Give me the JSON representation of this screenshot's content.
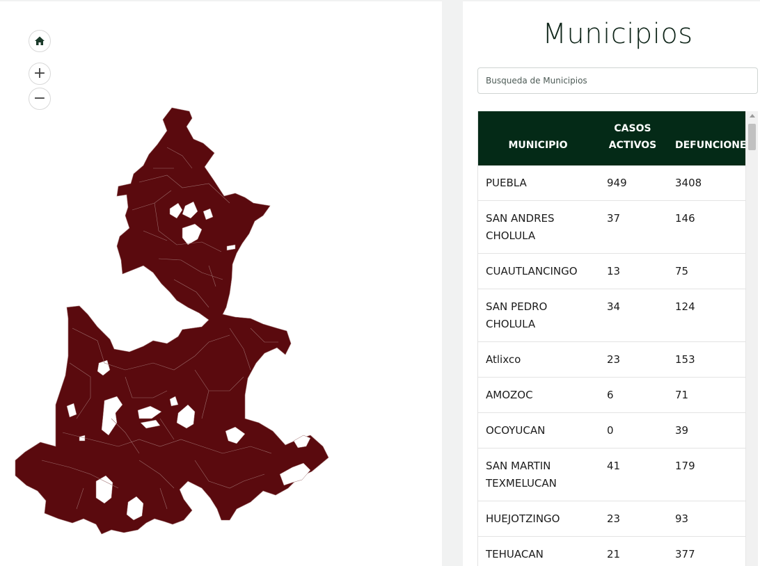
{
  "map": {
    "region_fill": "#5a0a0e",
    "region_stroke": "#9a6a6a",
    "controls": {
      "home_icon": "home-icon",
      "zoom_in_icon": "plus-icon",
      "zoom_out_icon": "minus-icon",
      "zoom_in_symbol": "+",
      "zoom_out_symbol": "−"
    }
  },
  "panel": {
    "title": "Municipios",
    "search_placeholder": "Busqueda de Municipios"
  },
  "table": {
    "header_bg": "#042a17",
    "columns": [
      "MUNICIPIO",
      "CASOS ACTIVOS",
      "DEFUNCIONES"
    ],
    "rows": [
      {
        "municipio": "PUEBLA",
        "casos_activos": "949",
        "defunciones": "3408"
      },
      {
        "municipio": "SAN ANDRES CHOLULA",
        "casos_activos": "37",
        "defunciones": "146"
      },
      {
        "municipio": "CUAUTLANCINGO",
        "casos_activos": "13",
        "defunciones": "75"
      },
      {
        "municipio": "SAN PEDRO CHOLULA",
        "casos_activos": "34",
        "defunciones": "124"
      },
      {
        "municipio": "Atlixco",
        "casos_activos": "23",
        "defunciones": "153"
      },
      {
        "municipio": "AMOZOC",
        "casos_activos": "6",
        "defunciones": "71"
      },
      {
        "municipio": "OCOYUCAN",
        "casos_activos": "0",
        "defunciones": "39"
      },
      {
        "municipio": "SAN MARTIN TEXMELUCAN",
        "casos_activos": "41",
        "defunciones": "179"
      },
      {
        "municipio": "HUEJOTZINGO",
        "casos_activos": "23",
        "defunciones": "93"
      },
      {
        "municipio": "TEHUACAN",
        "casos_activos": "21",
        "defunciones": "377"
      }
    ]
  }
}
